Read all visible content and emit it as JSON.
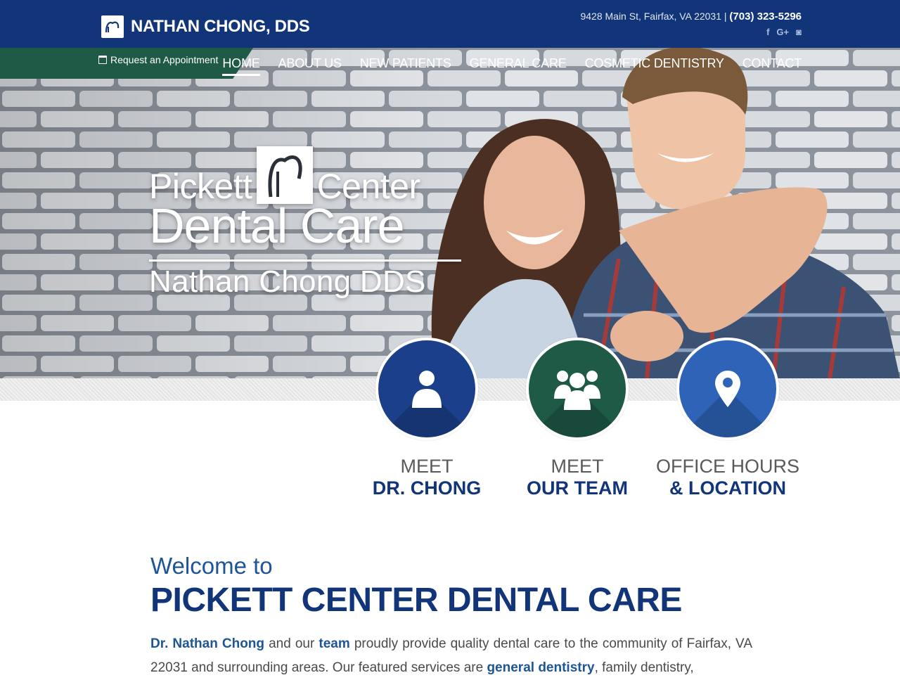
{
  "header": {
    "brand_name": "NATHAN CHONG, DDS",
    "address": "9428 Main St, Fairfax, VA 22031 |",
    "phone": "(703) 323-5296",
    "social": [
      "f",
      "G+",
      "◙"
    ]
  },
  "appointment": {
    "label": "Request an Appointment"
  },
  "nav": {
    "items": [
      "HOME",
      "ABOUT US",
      "NEW PATIENTS",
      "GENERAL CARE",
      "COSMETIC DENTISTRY",
      "CONTACT"
    ]
  },
  "hero": {
    "logo_word1": "Pickett",
    "logo_word2": "Center",
    "logo_line2": "Dental Care",
    "logo_line3": "Nathan Chong DDS"
  },
  "features": [
    {
      "top": "MEET",
      "bottom": "DR. CHONG",
      "icon": "user-icon",
      "color": "#1c3f8c"
    },
    {
      "top": "MEET",
      "bottom": "OUR TEAM",
      "icon": "team-icon",
      "color": "#1f5a47"
    },
    {
      "top": "OFFICE HOURS",
      "bottom": "& LOCATION",
      "icon": "map-pin-icon",
      "color": "#2e63b8"
    }
  ],
  "welcome": {
    "small": "Welcome to",
    "title": "PICKETT CENTER DENTAL CARE",
    "p_link1": "Dr. Nathan Chong",
    "p_t1": " and our ",
    "p_link2": "team",
    "p_t2": " proudly provide quality dental care to the community of Fairfax, VA 22031 and surrounding areas. Our featured services are ",
    "p_link3": "general dentistry",
    "p_t3": ", family dentistry,"
  },
  "colors": {
    "navy": "#12357a",
    "green": "#1e5a45",
    "blue": "#2e63b8"
  }
}
